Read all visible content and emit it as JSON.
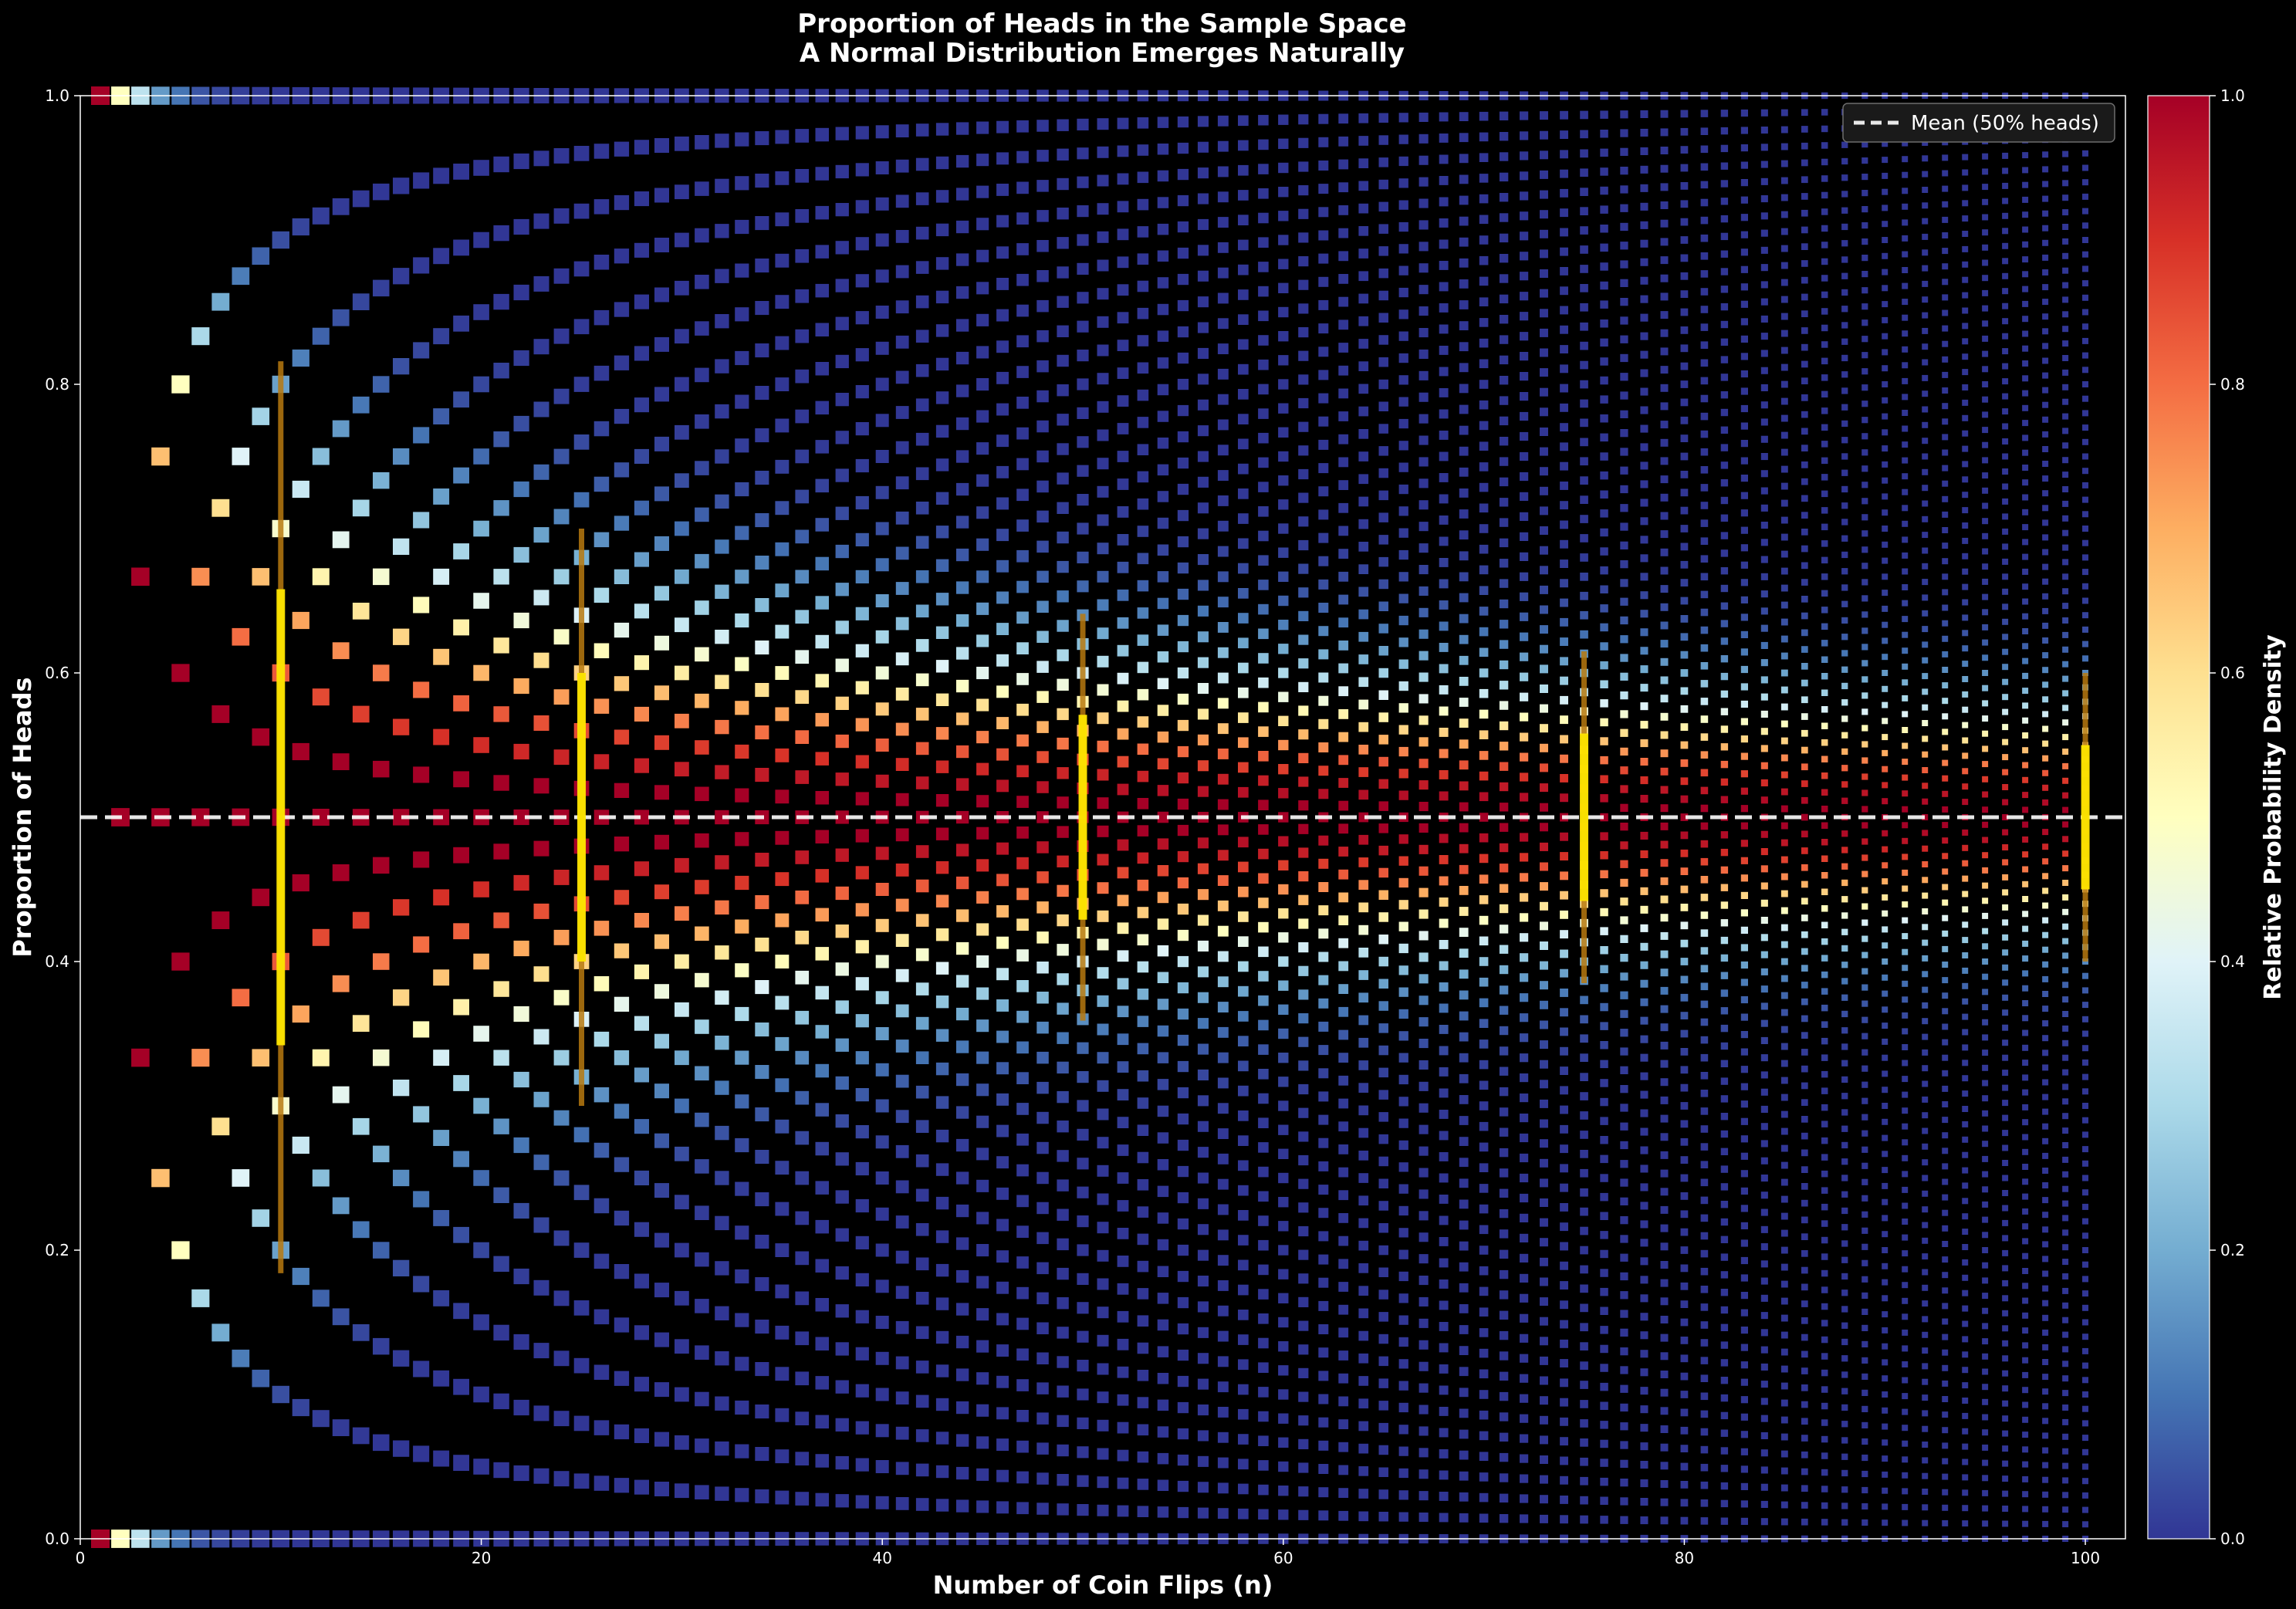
{
  "chart_data": {
    "type": "scatter",
    "title": "Proportion of Heads in the Sample Space",
    "subtitle": "A Normal Distribution Emerges Naturally",
    "xlabel": "Number of Coin Flips (n)",
    "ylabel": "Proportion of Heads",
    "xlim": [
      0,
      102
    ],
    "ylim": [
      0,
      1
    ],
    "x_ticks": [
      "0",
      "20",
      "40",
      "60",
      "80",
      "100"
    ],
    "y_ticks": [
      "0.0",
      "0.2",
      "0.4",
      "0.6",
      "0.8",
      "1.0"
    ],
    "grid": false,
    "background": "#000000",
    "points": {
      "description_of_data": "For each n from 1 to 100, one square at every proportion k/n (k = 0..n), colored by binomial probability C(n,k)/2^n relative to the most likely outcome for that n",
      "n_min": 1,
      "n_max": 100,
      "color_value": "relative_probability_density"
    },
    "reference_line": {
      "y": 0.5,
      "style": "dashed",
      "color": "#ffffff",
      "label": "Mean (50% heads)"
    },
    "intervals": [
      {
        "n": 10,
        "one_sd": [
          0.342,
          0.658
        ],
        "two_sd": [
          0.184,
          0.816
        ]
      },
      {
        "n": 25,
        "one_sd": [
          0.4,
          0.6
        ],
        "two_sd": [
          0.3,
          0.7
        ]
      },
      {
        "n": 50,
        "one_sd": [
          0.429,
          0.571
        ],
        "two_sd": [
          0.359,
          0.641
        ]
      },
      {
        "n": 75,
        "one_sd": [
          0.442,
          0.558
        ],
        "two_sd": [
          0.385,
          0.615
        ]
      },
      {
        "n": 100,
        "one_sd": [
          0.45,
          0.55
        ],
        "two_sd": [
          0.4,
          0.6
        ]
      }
    ],
    "interval_colors": {
      "one_sd": "#ffe600",
      "two_sd": "#b87a10"
    },
    "legend": {
      "placement": "top-right",
      "entries": [
        "Mean (50% heads)"
      ]
    },
    "colorbar": {
      "label": "Relative Probability Density",
      "range": [
        0,
        1
      ],
      "ticks": [
        "0.0",
        "0.2",
        "0.4",
        "0.6",
        "0.8",
        "1.0"
      ],
      "colormap": "RdYlBu_r",
      "stops": [
        "#313695",
        "#4575b4",
        "#74add1",
        "#abd9e9",
        "#e0f3f8",
        "#ffffbf",
        "#fee090",
        "#fdae61",
        "#f46d43",
        "#d73027",
        "#a50026"
      ]
    }
  }
}
